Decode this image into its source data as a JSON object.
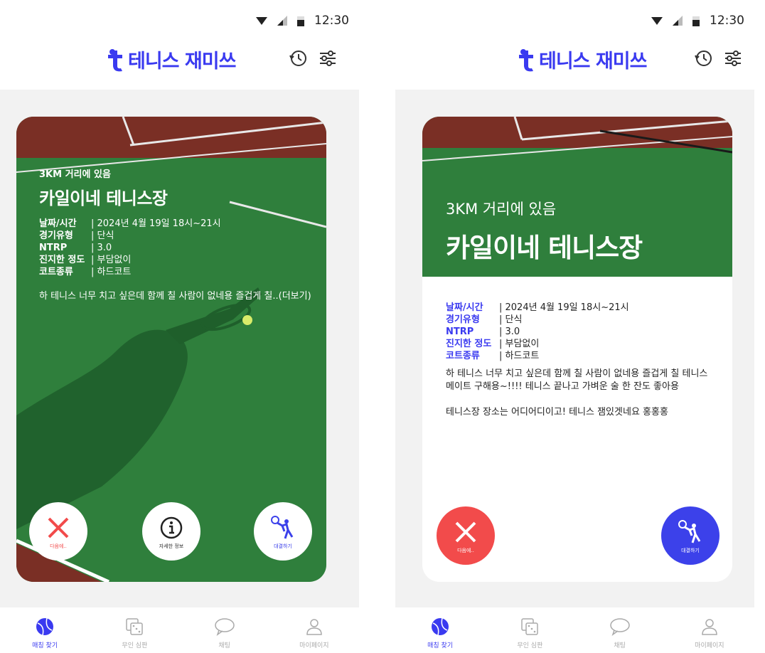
{
  "status_bar": {
    "time": "12:30"
  },
  "app": {
    "logo_text": "테니스 재미쓰",
    "brand_color": "#3a3af0"
  },
  "header_icons": [
    "history-icon",
    "filter-icon"
  ],
  "match_card": {
    "distance": "3KM 거리에 있음",
    "court_name": "카일이네 테니스장",
    "info": [
      {
        "label": "날짜/시간",
        "value": "| 2024년 4월 19일 18시~21시"
      },
      {
        "label": "경기유형",
        "value": "| 단식"
      },
      {
        "label": "NTRP",
        "value": "| 3.0"
      },
      {
        "label": "진지한 정도",
        "value": "| 부담없이"
      },
      {
        "label": "코트종류",
        "value": "| 하드코트"
      }
    ],
    "description_short": "하 테니스 너무 치고 싶은데 함께 칠 사람이 없네용 즐겁게 칠..(더보기)",
    "description_full_1": "하 테니스 너무 치고 싶은데 함께 칠 사람이 없네용 즐겁게 칠 테니스 메이트 구해용~!!!! 테니스 끝나고 가벼운 술 한 잔도 좋아용",
    "description_full_2": "테니스장 장소는 어디어디이고! 테니스 잼있겟네요 홍홍홍"
  },
  "actions": {
    "next": "다음에..",
    "info": "자세한 정보",
    "match": "대결하기"
  },
  "nav": [
    {
      "label": "매칭 찾기",
      "icon": "tennis-ball-icon",
      "active": true
    },
    {
      "label": "무인 심판",
      "icon": "dice-icon",
      "active": false
    },
    {
      "label": "채팅",
      "icon": "chat-bubble-icon",
      "active": false
    },
    {
      "label": "마이페이지",
      "icon": "person-icon",
      "active": false
    }
  ],
  "colors": {
    "red": "#f24b4b",
    "blue": "#3c41ea",
    "court_green": "#2f7f3c",
    "court_red": "#7a2f25"
  }
}
